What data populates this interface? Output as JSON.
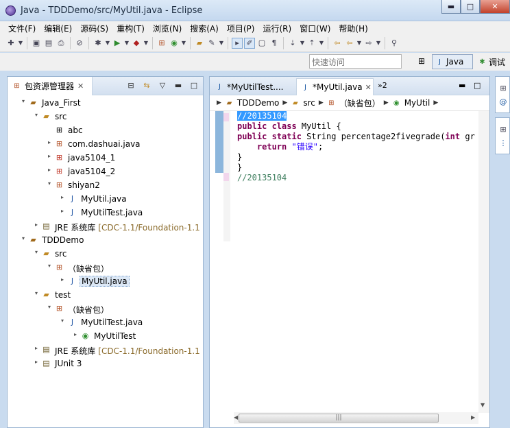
{
  "window": {
    "title": "Java  -  TDDDemo/src/MyUtil.java  -  Eclipse"
  },
  "window_controls": {
    "minimize": "▬",
    "maximize": "□",
    "close": "✕"
  },
  "menus": [
    "文件(F)",
    "编辑(E)",
    "源码(S)",
    "重构(T)",
    "浏览(N)",
    "搜索(A)",
    "项目(P)",
    "运行(R)",
    "窗口(W)",
    "帮助(H)"
  ],
  "quick_access": {
    "placeholder": "快速访问"
  },
  "perspectives": {
    "java": "Java",
    "debug": "调试"
  },
  "explorer": {
    "title": "包资源管理器",
    "tree": [
      {
        "level": 0,
        "twisty": "▾",
        "icon": "project-icon",
        "label": "Java_First",
        "decoration": ""
      },
      {
        "level": 1,
        "twisty": "▾",
        "icon": "source-folder-icon",
        "label": "src",
        "decoration": ""
      },
      {
        "level": 2,
        "twisty": "",
        "icon": "package-empty-icon",
        "label": "abc",
        "decoration": ""
      },
      {
        "level": 2,
        "twisty": "▸",
        "icon": "package-icon",
        "label": "com.dashuai.java",
        "decoration": ""
      },
      {
        "level": 2,
        "twisty": "▸",
        "icon": "package-error-icon",
        "label": "java5104_1",
        "decoration": ""
      },
      {
        "level": 2,
        "twisty": "▸",
        "icon": "package-error-icon",
        "label": "java5104_2",
        "decoration": ""
      },
      {
        "level": 2,
        "twisty": "▾",
        "icon": "package-icon",
        "label": "shiyan2",
        "decoration": ""
      },
      {
        "level": 3,
        "twisty": "▸",
        "icon": "java-file-icon",
        "label": "MyUtil.java",
        "decoration": ""
      },
      {
        "level": 3,
        "twisty": "▸",
        "icon": "java-file-icon",
        "label": "MyUtilTest.java",
        "decoration": ""
      },
      {
        "level": 1,
        "twisty": "▸",
        "icon": "library-icon",
        "label": "JRE 系统库",
        "decoration": "[CDC-1.1/Foundation-1.1"
      },
      {
        "level": 0,
        "twisty": "▾",
        "icon": "project-icon",
        "label": "TDDDemo",
        "decoration": ""
      },
      {
        "level": 1,
        "twisty": "▾",
        "icon": "source-folder-icon",
        "label": "src",
        "decoration": ""
      },
      {
        "level": 2,
        "twisty": "▾",
        "icon": "package-icon",
        "label": "（缺省包）",
        "decoration": ""
      },
      {
        "level": 3,
        "twisty": "▸",
        "icon": "java-file-icon",
        "label": "MyUtil.java",
        "decoration": "",
        "selected": true
      },
      {
        "level": 1,
        "twisty": "▾",
        "icon": "source-folder-icon",
        "label": "test",
        "decoration": ""
      },
      {
        "level": 2,
        "twisty": "▾",
        "icon": "package-icon",
        "label": "（缺省包）",
        "decoration": ""
      },
      {
        "level": 3,
        "twisty": "▾",
        "icon": "java-file-icon",
        "label": "MyUtilTest.java",
        "decoration": ""
      },
      {
        "level": 4,
        "twisty": "▸",
        "icon": "class-icon",
        "label": "MyUtilTest",
        "decoration": ""
      },
      {
        "level": 1,
        "twisty": "▸",
        "icon": "library-icon",
        "label": "JRE 系统库",
        "decoration": "[CDC-1.1/Foundation-1.1"
      },
      {
        "level": 1,
        "twisty": "▸",
        "icon": "library-icon",
        "label": "JUnit 3",
        "decoration": ""
      }
    ]
  },
  "editor": {
    "tabs": [
      {
        "label": "*MyUtilTest....",
        "active": false
      },
      {
        "label": "*MyUtil.java",
        "active": true
      }
    ],
    "overflow": "»2",
    "breadcrumb": [
      "TDDDemo",
      "src",
      "（缺省包）",
      "MyUtil"
    ],
    "code": [
      [
        {
          "t": "//20135104",
          "c": "cm hl"
        }
      ],
      [
        {
          "t": "public class ",
          "c": "kw"
        },
        {
          "t": "MyUtil {",
          "c": ""
        }
      ],
      [
        {
          "t": "public static ",
          "c": "kw"
        },
        {
          "t": "String percentage2fivegrade(",
          "c": ""
        },
        {
          "t": "int ",
          "c": "kw"
        },
        {
          "t": "gr",
          "c": ""
        }
      ],
      [
        {
          "t": "    return ",
          "c": "kw"
        },
        {
          "t": "\"错误\"",
          "c": "str"
        },
        {
          "t": ";",
          "c": ""
        }
      ],
      [
        {
          "t": "}",
          "c": ""
        }
      ],
      [
        {
          "t": "}",
          "c": ""
        }
      ],
      [
        {
          "t": "//20135104",
          "c": "cm"
        }
      ]
    ]
  },
  "colors": {
    "keyword": "#7f0055",
    "comment": "#3f7f5f",
    "string": "#2a00ff",
    "selection": "#3399ff"
  }
}
